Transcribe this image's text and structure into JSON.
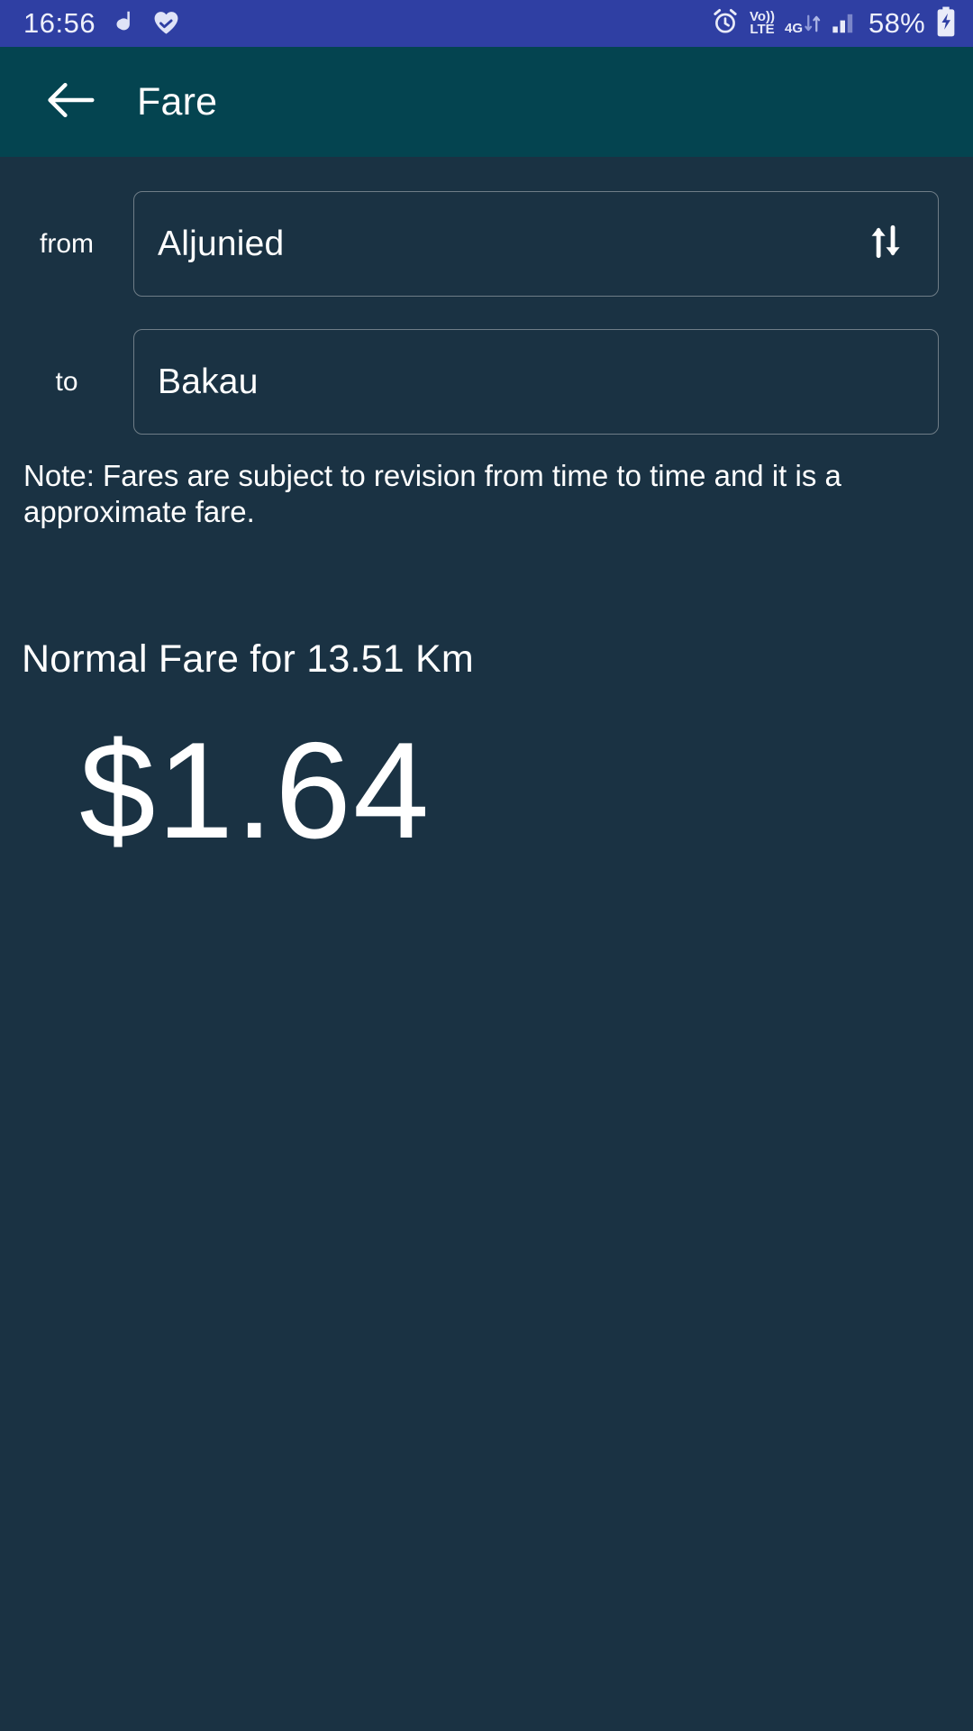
{
  "statusbar": {
    "time": "16:56",
    "app_icon_letter": "d",
    "battery_percent": "58%",
    "network_label": "4G",
    "volte_line1": "Vo))",
    "volte_line2": "LTE",
    "icons": [
      "app-d-icon",
      "heart-check-icon",
      "alarm-icon",
      "volte-icon",
      "network-4g-icon",
      "signal-bars-icon",
      "battery-charging-icon"
    ],
    "colors": {
      "background": "#2f3fa3",
      "foreground": "#e9ebf8"
    }
  },
  "appbar": {
    "title": "Fare",
    "back_icon": "arrow-left-icon",
    "colors": {
      "background": "#044450",
      "foreground": "#ffffff"
    }
  },
  "form": {
    "from": {
      "label": "from",
      "value": "Aljunied"
    },
    "to": {
      "label": "to",
      "value": "Bakau"
    },
    "swap_icon": "swap-vertical-icon"
  },
  "note": "Note: Fares are subject to revision from time to time and it is a approximate fare.",
  "result": {
    "heading": "Normal Fare for 13.51 Km",
    "distance": "13.51 Km",
    "amount": "$1.64"
  },
  "theme": {
    "page_background": "#1a3243",
    "field_border": "#6f7d87",
    "text_primary": "#ffffff"
  }
}
